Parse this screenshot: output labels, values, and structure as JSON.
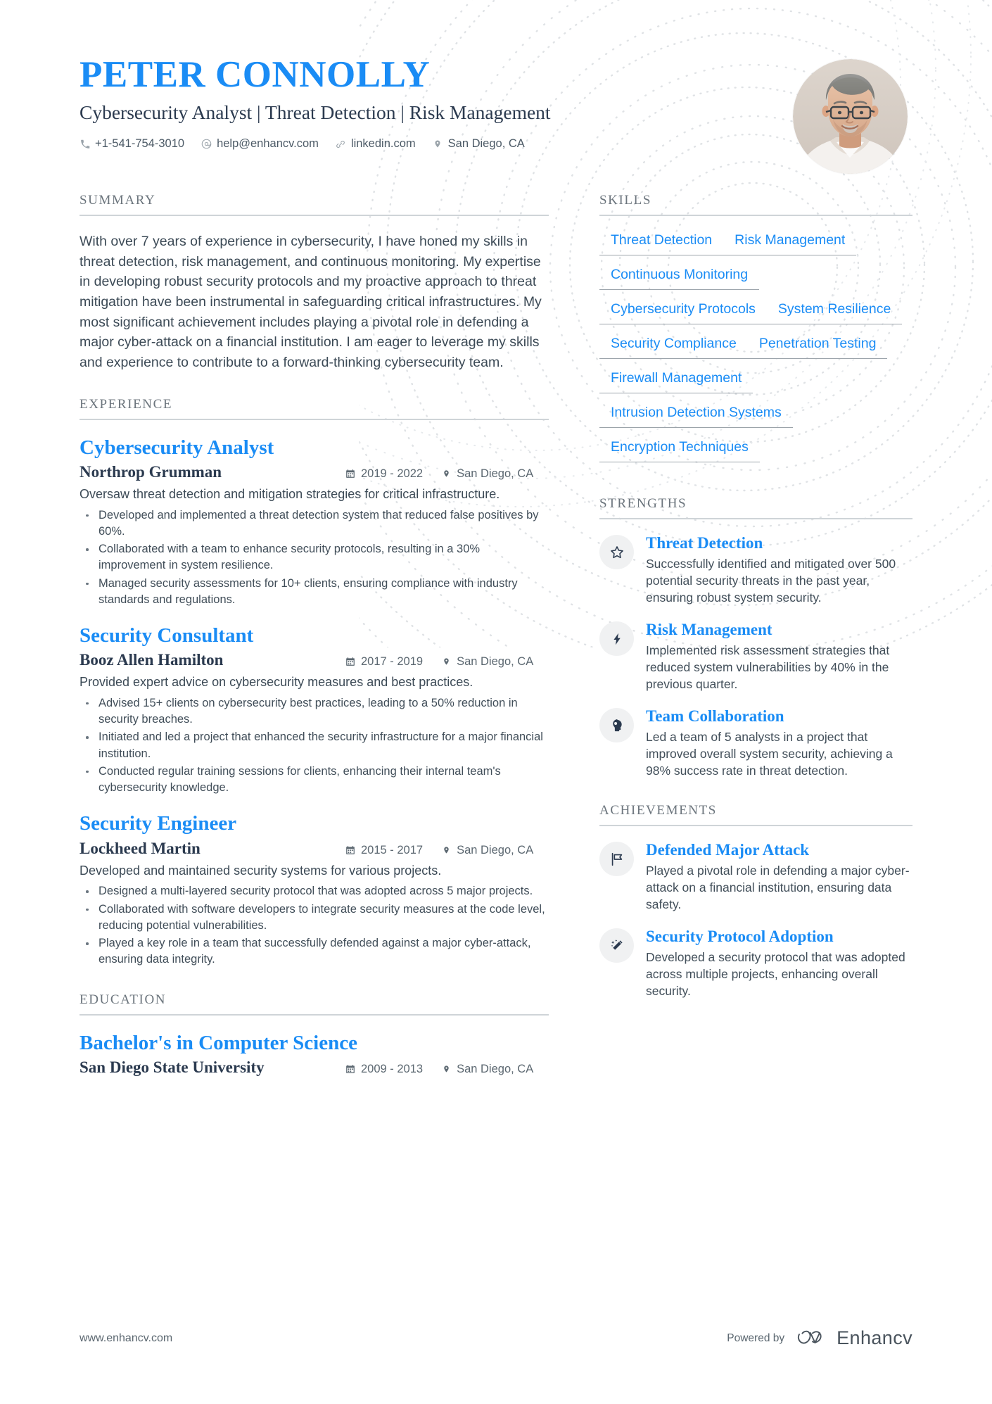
{
  "colors": {
    "accent_blue": "#1a8cf5",
    "heading_gray": "#6c757d",
    "dark_navy": "#2b3a4f",
    "body_text": "#3c4a56"
  },
  "header": {
    "name": "PETER CONNOLLY",
    "title": "Cybersecurity Analyst | Threat Detection | Risk Management",
    "contacts": [
      {
        "icon": "phone-icon",
        "text": "+1-541-754-3010"
      },
      {
        "icon": "email-icon",
        "text": "help@enhancv.com"
      },
      {
        "icon": "link-icon",
        "text": "linkedin.com"
      },
      {
        "icon": "location-pin-icon",
        "text": "San Diego, CA"
      }
    ],
    "photo_alt": "portrait-photo"
  },
  "summary": {
    "heading": "SUMMARY",
    "text": "With over 7 years of experience in cybersecurity, I have honed my skills in threat detection, risk management, and continuous monitoring. My expertise in developing robust security protocols and my proactive approach to threat mitigation have been instrumental in safeguarding critical infrastructures. My most significant achievement includes playing a pivotal role in defending a major cyber-attack on a financial institution. I am eager to leverage my skills and experience to contribute to a forward-thinking cybersecurity team."
  },
  "experience": {
    "heading": "EXPERIENCE",
    "jobs": [
      {
        "role": "Cybersecurity Analyst",
        "company": "Northrop Grumman",
        "dates": "2019 - 2022",
        "location": "San Diego, CA",
        "description": "Oversaw threat detection and mitigation strategies for critical infrastructure.",
        "bullets": [
          "Developed and implemented a threat detection system that reduced false positives by 60%.",
          "Collaborated with a team to enhance security protocols, resulting in a 30% improvement in system resilience.",
          "Managed security assessments for 10+ clients, ensuring compliance with industry standards and regulations."
        ]
      },
      {
        "role": "Security Consultant",
        "company": "Booz Allen Hamilton",
        "dates": "2017 - 2019",
        "location": "San Diego, CA",
        "description": "Provided expert advice on cybersecurity measures and best practices.",
        "bullets": [
          "Advised 15+ clients on cybersecurity best practices, leading to a 50% reduction in security breaches.",
          "Initiated and led a project that enhanced the security infrastructure for a major financial institution.",
          "Conducted regular training sessions for clients, enhancing their internal team's cybersecurity knowledge."
        ]
      },
      {
        "role": "Security Engineer",
        "company": "Lockheed Martin",
        "dates": "2015 - 2017",
        "location": "San Diego, CA",
        "description": "Developed and maintained security systems for various projects.",
        "bullets": [
          "Designed a multi-layered security protocol that was adopted across 5 major projects.",
          "Collaborated with software developers to integrate security measures at the code level, reducing potential vulnerabilities.",
          "Played a key role in a team that successfully defended against a major cyber-attack, ensuring data integrity."
        ]
      }
    ]
  },
  "education": {
    "heading": "EDUCATION",
    "entries": [
      {
        "degree": "Bachelor's in Computer Science",
        "school": "San Diego State University",
        "dates": "2009 - 2013",
        "location": "San Diego, CA"
      }
    ]
  },
  "skills": {
    "heading": "SKILLS",
    "items": [
      "Threat Detection",
      "Risk Management",
      "Continuous Monitoring",
      "Cybersecurity Protocols",
      "System Resilience",
      "Security Compliance",
      "Penetration Testing",
      "Firewall Management",
      "Intrusion Detection Systems",
      "Encryption Techniques"
    ]
  },
  "strengths": {
    "heading": "STRENGTHS",
    "items": [
      {
        "icon": "star-icon",
        "title": "Threat Detection",
        "description": "Successfully identified and mitigated over 500 potential security threats in the past year, ensuring robust system security."
      },
      {
        "icon": "lightning-bolt-icon",
        "title": "Risk Management",
        "description": "Implemented risk assessment strategies that reduced system vulnerabilities by 40% in the previous quarter."
      },
      {
        "icon": "head-profile-icon",
        "title": "Team Collaboration",
        "description": "Led a team of 5 analysts in a project that improved overall system security, achieving a 98% success rate in threat detection."
      }
    ]
  },
  "achievements": {
    "heading": "ACHIEVEMENTS",
    "items": [
      {
        "icon": "flag-icon",
        "title": "Defended Major Attack",
        "description": "Played a pivotal role in defending a major cyber-attack on a financial institution, ensuring data safety."
      },
      {
        "icon": "magic-wand-icon",
        "title": "Security Protocol Adoption",
        "description": "Developed a security protocol that was adopted across multiple projects, enhancing overall security."
      }
    ]
  },
  "footer": {
    "url": "www.enhancv.com",
    "powered_by": "Powered by",
    "brand": "Enhancv"
  }
}
